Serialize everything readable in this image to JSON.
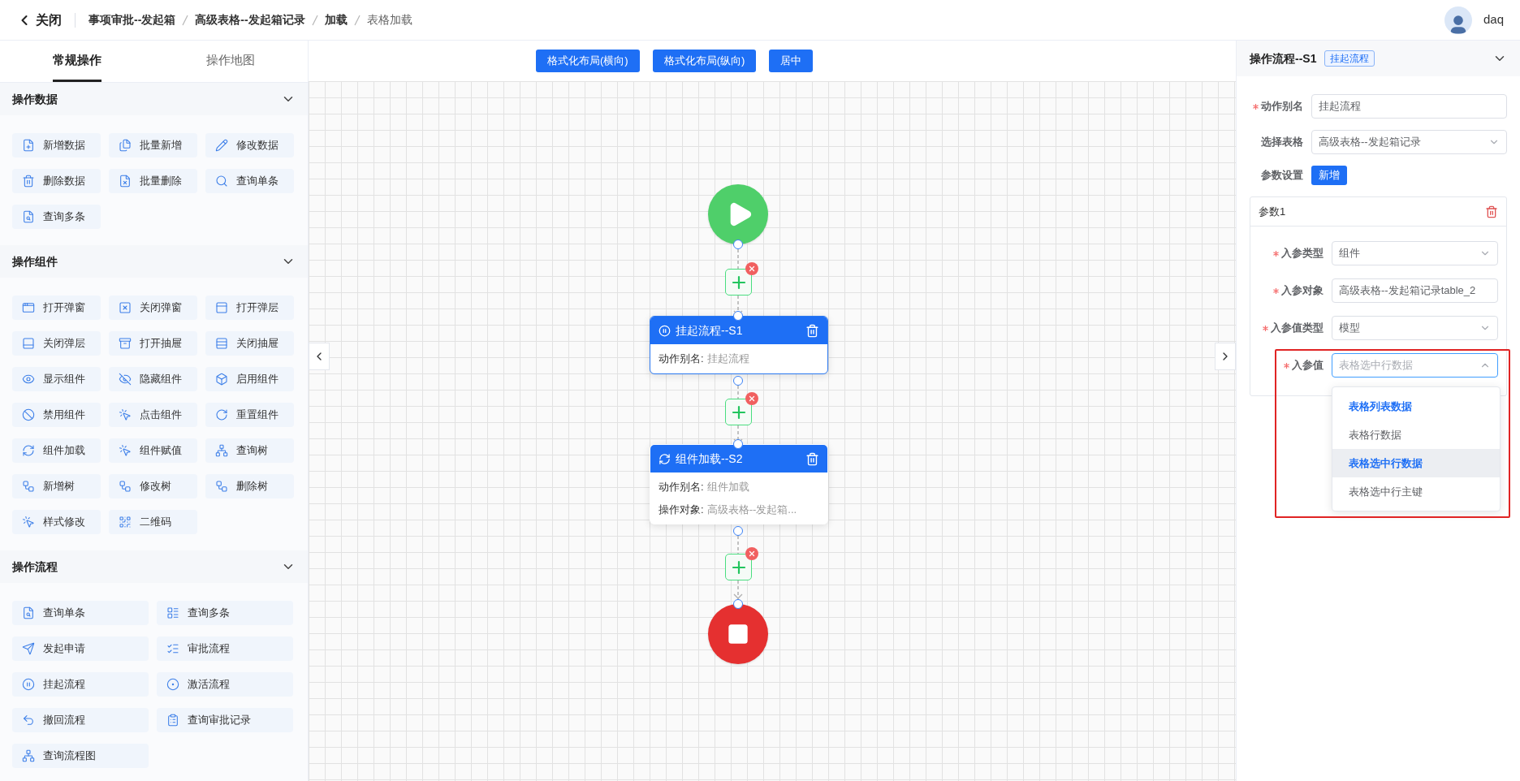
{
  "header": {
    "close": "关闭",
    "breadcrumbs": [
      {
        "label": "事项审批--发起箱",
        "current": false
      },
      {
        "label": "高级表格--发起箱记录",
        "current": false
      },
      {
        "label": "加载",
        "current": false
      },
      {
        "label": "表格加载",
        "current": true
      }
    ],
    "user": "daq"
  },
  "left_panel": {
    "tabs": [
      {
        "label": "常规操作",
        "selected": true
      },
      {
        "label": "操作地图",
        "selected": false
      }
    ],
    "sections": [
      {
        "title": "操作数据",
        "expanded": true,
        "kind": "compact",
        "items": [
          "新增数据",
          "批量新增",
          "修改数据",
          "删除数据",
          "批量删除",
          "查询单条",
          "查询多条"
        ]
      },
      {
        "title": "操作组件",
        "expanded": true,
        "kind": "compact",
        "items": [
          "打开弹窗",
          "关闭弹窗",
          "打开弹层",
          "关闭弹层",
          "打开抽屉",
          "关闭抽屉",
          "显示组件",
          "隐藏组件",
          "启用组件",
          "禁用组件",
          "点击组件",
          "重置组件",
          "组件加载",
          "组件赋值",
          "查询树",
          "新增树",
          "修改树",
          "删除树",
          "样式修改",
          "二维码"
        ]
      },
      {
        "title": "操作流程",
        "expanded": true,
        "kind": "wide",
        "items": [
          "查询单条",
          "查询多条",
          "发起申请",
          "审批流程",
          "挂起流程",
          "激活流程",
          "撤回流程",
          "查询审批记录",
          "查询流程图"
        ]
      }
    ]
  },
  "canvas": {
    "toolbar": [
      "格式化布局(横向)",
      "格式化布局(纵向)",
      "居中"
    ],
    "steps": [
      {
        "title": "挂起流程--S1",
        "selected": true,
        "fields": [
          {
            "label": "动作别名:",
            "value": "挂起流程"
          }
        ]
      },
      {
        "title": "组件加载--S2",
        "selected": false,
        "fields": [
          {
            "label": "动作别名:",
            "value": "组件加载"
          },
          {
            "label": "操作对象:",
            "value": "高级表格--发起箱..."
          }
        ]
      }
    ]
  },
  "right_panel": {
    "title": "操作流程--S1",
    "tag": "挂起流程",
    "expanded": true,
    "fields": [
      {
        "label": "动作别名",
        "required": true,
        "kind": "input",
        "value": "挂起流程"
      },
      {
        "label": "选择表格",
        "required": false,
        "kind": "select",
        "value": "高级表格--发起箱记录"
      }
    ],
    "params_label": "参数设置",
    "add_button": "新增",
    "param": {
      "title": "参数1",
      "fields": [
        {
          "label": "入参类型",
          "required": true,
          "kind": "select",
          "value": "组件",
          "open": false
        },
        {
          "label": "入参对象",
          "required": true,
          "kind": "input",
          "value": "高级表格--发起箱记录table_2"
        },
        {
          "label": "入参值类型",
          "required": true,
          "kind": "select",
          "value": "模型",
          "open": false
        },
        {
          "label": "入参值",
          "required": true,
          "kind": "select",
          "placeholder": "表格选中行数据",
          "open": true
        }
      ]
    },
    "options": [
      {
        "label": "表格列表数据",
        "selected": true,
        "highlighted": false
      },
      {
        "label": "表格行数据",
        "selected": false,
        "highlighted": false
      },
      {
        "label": "表格选中行数据",
        "selected": true,
        "highlighted": true
      },
      {
        "label": "表格选中行主键",
        "selected": false,
        "highlighted": false
      }
    ]
  }
}
